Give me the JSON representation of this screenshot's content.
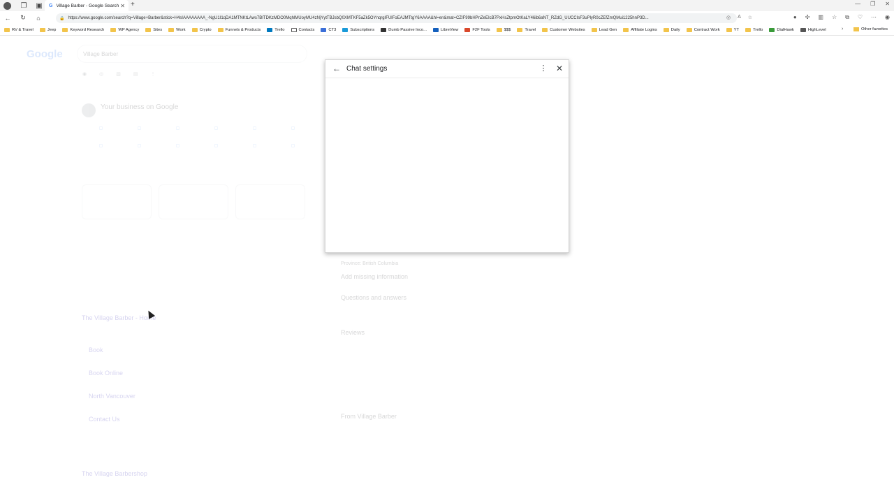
{
  "browser": {
    "tab_title": "Village Barber - Google Search",
    "url": "https://www.google.com/search?q=Village+Barber&stick=H4sIAAAAAAAA_-NgU1I1qDA1MTNKtLAws7BITDKzMDO0MqhlMUoyMU4zNjYytTBJsbQ0XMTKF5aZk5OYnqrgIFUlFoEAJMTtgY6AAAA&hl=en&mat=CZIF99bHPnZeEIcB7PxHsZtpmOtKaLY46ib6aNT_RZdG_UUCCIsF3uPlyR0cZEfZmQMui1225hnP3D...",
    "bookmarks": [
      "RV & Travel",
      "Jeep",
      "Keyword Research",
      "WP Agency",
      "Sites",
      "Work",
      "Crypto",
      "Funnels & Products",
      "Trello",
      "Contacts",
      "CT3",
      "Subscriptions",
      "Dumb Passive Inco...",
      "LibreView",
      "F2F Tools",
      "$$$",
      "Travel",
      "Customer Websites",
      "Lead Gen",
      "Affiliate Logins",
      "Daily",
      "Contract Work",
      "YT",
      "Trello",
      "DialHawk",
      "HighLevel"
    ],
    "other_favorites": "Other favorites"
  },
  "page": {
    "logo": "Google",
    "search_query": "Village Barber",
    "business_title": "Your business on Google",
    "result1_title": "The Village Barber - Home",
    "result1_links": [
      "Book",
      "Book Online",
      "North Vancouver",
      "Contact Us"
    ],
    "result2_title": "The Village Barbershop",
    "right_panel_lines": [
      "Province: British Columbia",
      "Add missing information",
      "Questions and answers",
      "Reviews",
      "From Village Barber"
    ]
  },
  "dialog": {
    "title": "Chat settings",
    "back_icon": "arrow-left-icon",
    "menu_icon": "more-vert-icon",
    "close_icon": "close-icon"
  }
}
